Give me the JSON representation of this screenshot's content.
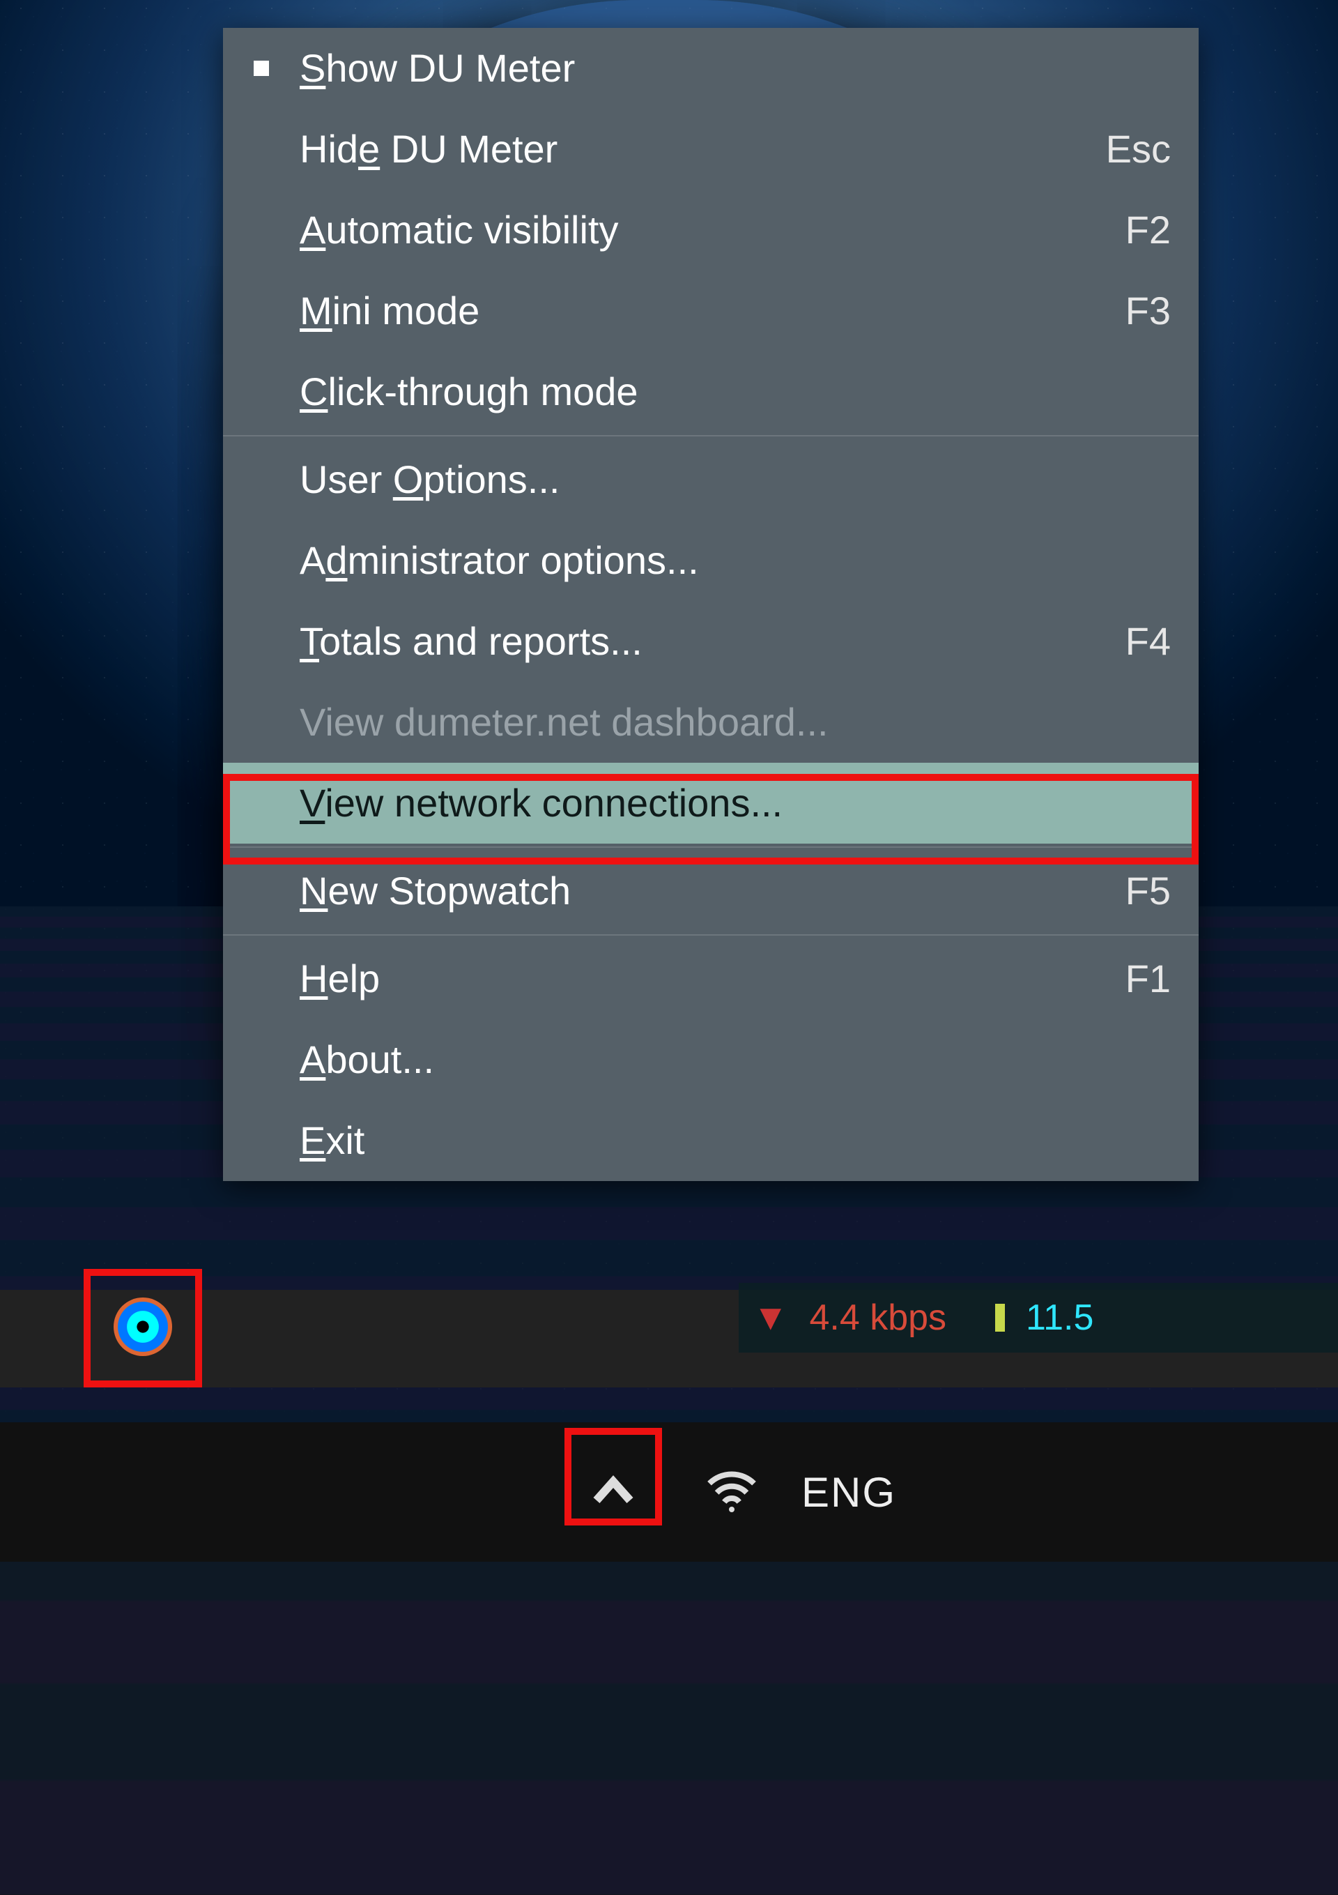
{
  "menu": {
    "items": [
      {
        "label": "Show DU Meter",
        "u": 0,
        "accel": "",
        "checked": true
      },
      {
        "label": "Hide DU Meter",
        "u": 3,
        "accel": "Esc"
      },
      {
        "label": "Automatic visibility",
        "u": 0,
        "accel": "F2"
      },
      {
        "label": "Mini mode",
        "u": 0,
        "accel": "F3"
      },
      {
        "label": "Click-through mode",
        "u": 0,
        "accel": ""
      }
    ],
    "items2": [
      {
        "label": "User Options...",
        "u": 5,
        "accel": ""
      },
      {
        "label": "Administrator options...",
        "u": 1,
        "accel": ""
      },
      {
        "label": "Totals and reports...",
        "u": 0,
        "accel": "F4"
      },
      {
        "label": "View dumeter.net dashboard...",
        "u": -1,
        "accel": "",
        "disabled": true
      },
      {
        "label": "View network connections...",
        "u": 0,
        "accel": "",
        "hover": true
      }
    ],
    "items3": [
      {
        "label": "New Stopwatch",
        "u": 0,
        "accel": "F5"
      }
    ],
    "items4": [
      {
        "label": "Help",
        "u": 0,
        "accel": "F1"
      },
      {
        "label": "About...",
        "u": 0,
        "accel": ""
      },
      {
        "label": "Exit",
        "u": 0,
        "accel": ""
      }
    ]
  },
  "du_widget": {
    "down": "4.4 kbps",
    "up": "11.5"
  },
  "taskbar": {
    "lang": "ENG"
  }
}
